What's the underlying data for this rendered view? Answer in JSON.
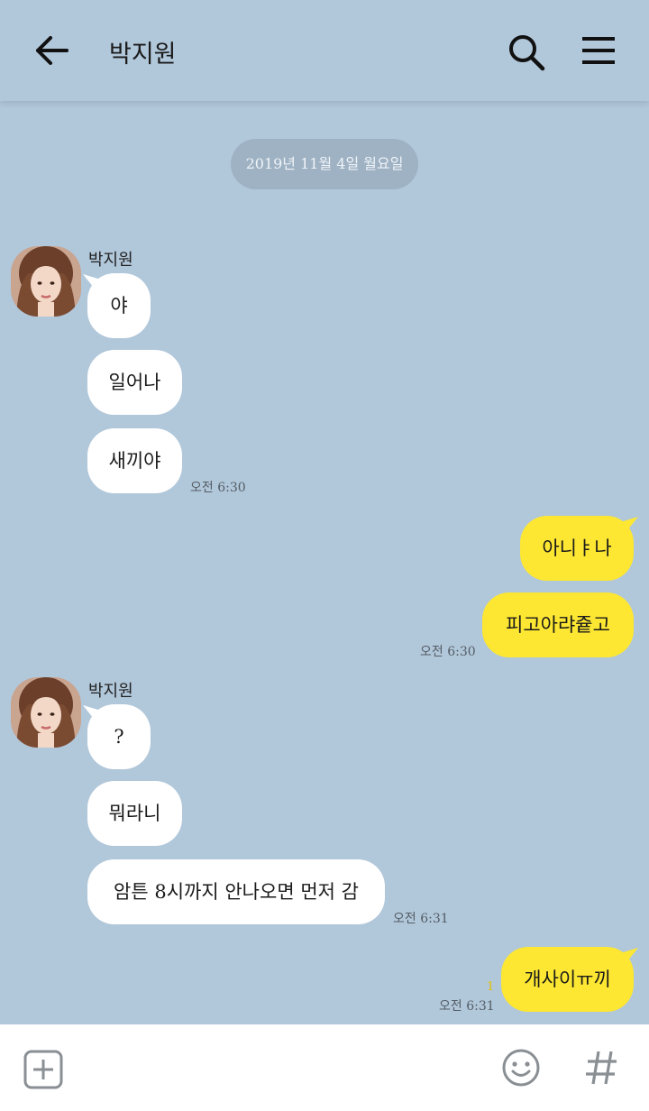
{
  "header": {
    "title": "박지원",
    "back_icon": "arrow-left-icon",
    "search_icon": "search-icon",
    "menu_icon": "hamburger-menu-icon"
  },
  "chat": {
    "date": "2019년 11월 4일 월요일",
    "groups": [
      {
        "sender": "박지원",
        "messages": [
          "야",
          "일어나",
          "새끼야"
        ],
        "time": "오전 6:30"
      },
      {
        "messages": [
          "아니ㅑ나",
          "피고아랴즅고"
        ],
        "time": "오전 6:30"
      },
      {
        "sender": "박지원",
        "messages": [
          "?",
          "뭐라니",
          "암튼 8시까지 안나오면 먼저 감"
        ],
        "time": "오전 6:31"
      },
      {
        "messages": [
          "개사이ㅠ끼"
        ],
        "time": "오전 6:31",
        "unread": "1"
      }
    ]
  },
  "input_bar": {
    "plus_icon": "plus-square-icon",
    "emoji_icon": "smiley-emoji-icon",
    "hash_icon": "hashtag-icon"
  },
  "colors": {
    "background": "#b1c7da",
    "incoming_bubble": "#ffffff",
    "outgoing_bubble": "#fde732",
    "date_pill": "#9fb2c3"
  }
}
